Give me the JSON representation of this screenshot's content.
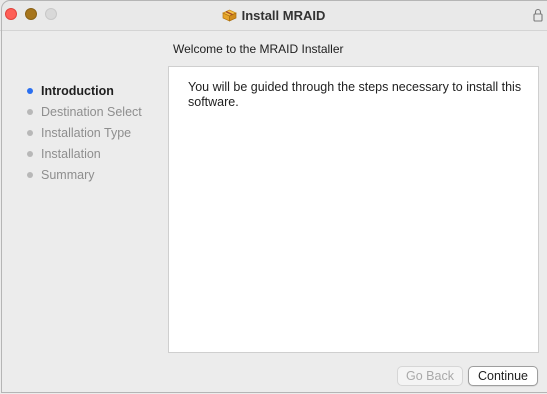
{
  "window": {
    "title": "Install MRAID"
  },
  "header": {
    "welcome": "Welcome to the MRAID Installer"
  },
  "sidebar": {
    "steps": [
      {
        "label": "Introduction",
        "active": true
      },
      {
        "label": "Destination Select",
        "active": false
      },
      {
        "label": "Installation Type",
        "active": false
      },
      {
        "label": "Installation",
        "active": false
      },
      {
        "label": "Summary",
        "active": false
      }
    ]
  },
  "content": {
    "body": "You will be guided through the steps necessary to install this software."
  },
  "buttons": {
    "back_label": "Go Back",
    "continue_label": "Continue"
  },
  "colors": {
    "active_step_dot": "#2a6ff0",
    "close": "#fe5f57",
    "minimize": "#a6751c",
    "zoom": "#d9d9d9"
  },
  "icons": {
    "title_icon": "installer-package-icon",
    "right_icon": "lock-icon"
  }
}
